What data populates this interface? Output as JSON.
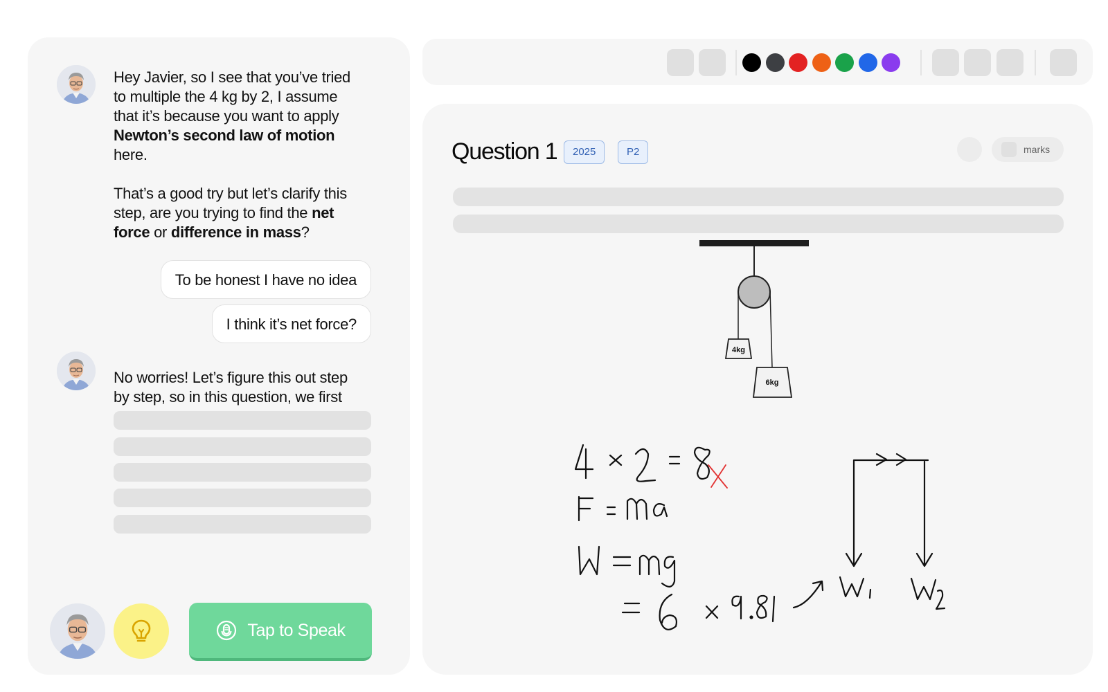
{
  "chat": {
    "message1": {
      "p1_text": "Hey Javier, so I see that you’ve tried to multiple the 4 kg by 2, I assume that it’s because you want to apply ",
      "p1_bold": "Newton’s second law of motion",
      "p1_end": " here.",
      "p2_text": "That’s a good try but let’s clarify this step, are you trying to find the ",
      "p2_bold1": "net force",
      "p2_mid": " or ",
      "p2_bold2": "difference in mass",
      "p2_end": "?"
    },
    "replies": [
      "To be honest I have no idea",
      "I think it’s net force?"
    ],
    "message2": "No worries! Let’s figure this out step by step, so in this question, we first",
    "speak_button_label": "Tap to Speak"
  },
  "toolbar": {
    "colors": [
      "#000000",
      "#3d3f43",
      "#e32222",
      "#ee6116",
      "#1aa24a",
      "#2167e8",
      "#8a3cee"
    ]
  },
  "question": {
    "title": "Question 1",
    "badges": [
      "2025",
      "P2"
    ],
    "marks_label": "marks",
    "diagram": {
      "mass_left": "4kg",
      "mass_right": "6kg"
    },
    "handwriting": {
      "line1": "4 × 2 = 8",
      "line2": "F = ma",
      "line3": "W = mg",
      "line4": "= 6 × 9.81",
      "w1": "W₁",
      "w2": "W₂"
    }
  }
}
